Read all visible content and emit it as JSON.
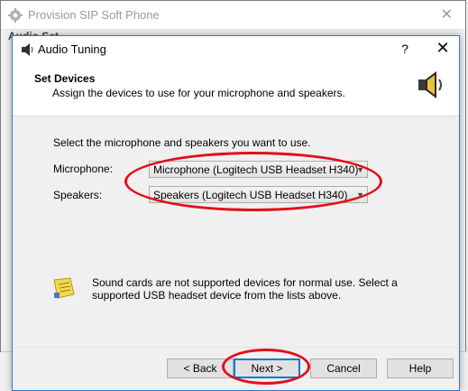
{
  "background_window": {
    "title": "Provision SIP Soft Phone",
    "close_glyph": "✕",
    "partial_text": "Audio Set"
  },
  "dialog": {
    "title": "Audio Tuning",
    "help_glyph": "?",
    "close_glyph": "✕",
    "header_title": "Set Devices",
    "header_subtitle": "Assign the devices to use for your microphone and speakers.",
    "instruction": "Select the microphone and speakers you want to use.",
    "microphone_label": "Microphone:",
    "microphone_value": "Microphone (Logitech USB Headset H340)",
    "speakers_label": "Speakers:",
    "speakers_value": "Speakers (Logitech USB Headset H340)",
    "note": "Sound cards are not supported devices for normal use. Select a supported USB headset device from the lists above.",
    "buttons": {
      "back": "< Back",
      "next": "Next >",
      "cancel": "Cancel",
      "help": "Help"
    }
  },
  "colors": {
    "annotation_red": "#e0101a",
    "focus_blue": "#0078d7"
  },
  "icons": [
    "gear-app-icon",
    "speaker-icon",
    "note-icon",
    "dropdown-arrow-icon"
  ]
}
